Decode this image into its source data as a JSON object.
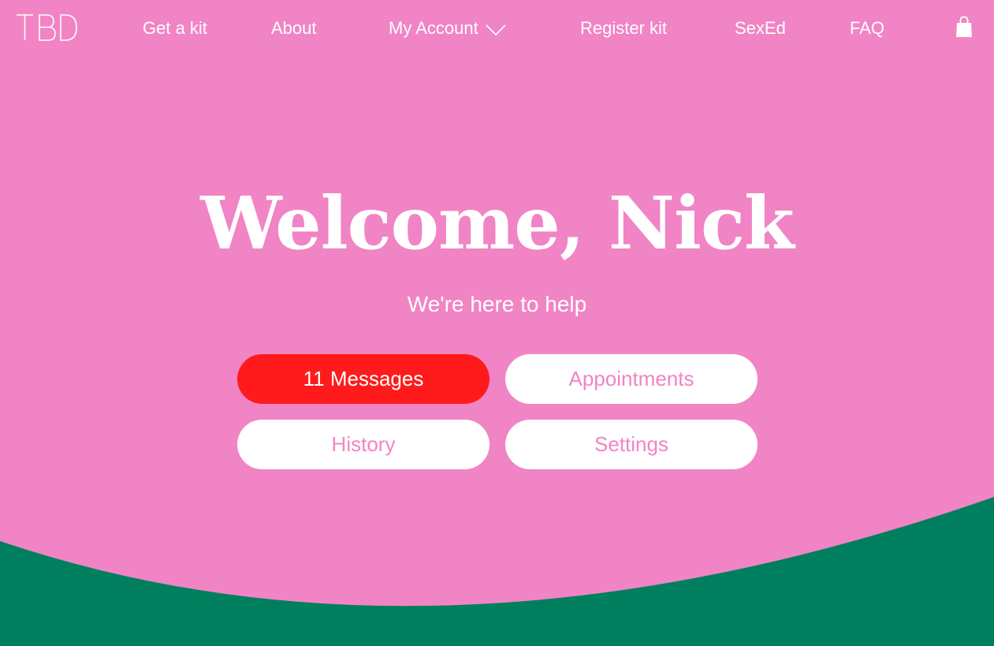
{
  "brand": {
    "logo_text": "TBD"
  },
  "nav": {
    "items": [
      {
        "label": "Get a kit"
      },
      {
        "label": "About"
      },
      {
        "label": "My Account"
      },
      {
        "label": "Register kit"
      },
      {
        "label": "SexEd"
      },
      {
        "label": "FAQ"
      }
    ],
    "cart_icon": "shopping-bag-icon",
    "dropdown_icon": "chevron-down-icon"
  },
  "hero": {
    "title": "Welcome, Nick",
    "subtitle": "We're here to help"
  },
  "actions": {
    "messages": "11 Messages",
    "appointments": "Appointments",
    "history": "History",
    "settings": "Settings"
  },
  "colors": {
    "background": "#f184c4",
    "accent": "#ff1b1b",
    "wave": "#007f5f",
    "button_bg": "#ffffff",
    "text_light": "#ffffff"
  }
}
